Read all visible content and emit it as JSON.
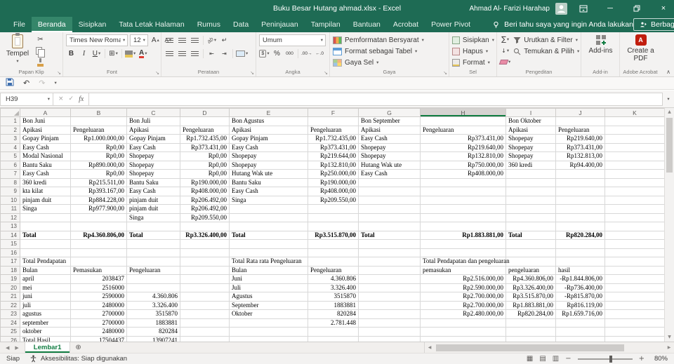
{
  "titlebar": {
    "title": "Buku Besar Hutang ahmad.xlsx  -  Excel",
    "user": "Ahmad Al- Farizi Harahap"
  },
  "tabs": {
    "items": [
      {
        "label": "File",
        "active": false
      },
      {
        "label": "Beranda",
        "active": true
      },
      {
        "label": "Sisipkan",
        "active": false
      },
      {
        "label": "Tata Letak Halaman",
        "active": false
      },
      {
        "label": "Rumus",
        "active": false
      },
      {
        "label": "Data",
        "active": false
      },
      {
        "label": "Peninjauan",
        "active": false
      },
      {
        "label": "Tampilan",
        "active": false
      },
      {
        "label": "Bantuan",
        "active": false
      },
      {
        "label": "Acrobat",
        "active": false
      },
      {
        "label": "Power Pivot",
        "active": false
      }
    ],
    "tellme": "Beri tahu saya yang ingin Anda lakukan",
    "share": "Berbagi"
  },
  "ribbon": {
    "clipboard": {
      "label": "Papan Klip",
      "paste": "Tempel"
    },
    "font": {
      "label": "Font",
      "name": "Times New Roman",
      "size": "12"
    },
    "alignment": {
      "label": "Perataan"
    },
    "number": {
      "label": "Angka",
      "format": "Umum"
    },
    "styles": {
      "label": "Gaya",
      "buttons": [
        "Pemformatan Bersyarat",
        "Format sebagai Tabel",
        "Gaya Sel"
      ]
    },
    "cells": {
      "label": "Sel",
      "buttons": [
        "Sisipkan",
        "Hapus",
        "Format"
      ]
    },
    "editing": {
      "label": "Pengeditan",
      "buttons": [
        "Urutkan & Filter",
        "Temukan & Pilih"
      ]
    },
    "addins": {
      "label": "Add-in",
      "button": "Add-ins"
    },
    "acrobat": {
      "label": "Adobe Acrobat",
      "button": "Create a PDF"
    }
  },
  "formula_bar": {
    "name_box": "H39"
  },
  "grid": {
    "columns": [
      "A",
      "B",
      "C",
      "D",
      "E",
      "F",
      "G",
      "H",
      "I",
      "J",
      "K"
    ],
    "selected_column": "H",
    "selected_cell": "H39",
    "bold_rows": [
      14
    ],
    "rows": [
      {
        "n": 1,
        "c": [
          "Bon Juni",
          "",
          "Bon Juli",
          "",
          "Bon Agustus",
          "",
          "Bon September",
          "",
          "Bon Oktober",
          "",
          ""
        ]
      },
      {
        "n": 2,
        "c": [
          "Apikasi",
          "Pengeluaran",
          "Apikasi",
          "Pengeluaran",
          "Apikasi",
          "Pengeluaran",
          "Apikasi",
          "Pengeluaran",
          "Apikasi",
          "Pengeluaran",
          ""
        ]
      },
      {
        "n": 3,
        "c": [
          "Gopay Pinjam",
          "Rp1.000.000,00",
          "Gopay Pinjam",
          "Rp1.732.435,00",
          "Gopay Pinjam",
          "Rp1.732.435,00",
          "Easy Cash",
          "Rp373.431,00",
          "Shopepay",
          "Rp219.640,00",
          ""
        ]
      },
      {
        "n": 4,
        "c": [
          "Easy Cash",
          "Rp0,00",
          "Easy Cash",
          "Rp373.431,00",
          "Easy Cash",
          "Rp373.431,00",
          "Shopepay",
          "Rp219.640,00",
          "Shopepay",
          "Rp373.431,00",
          ""
        ]
      },
      {
        "n": 5,
        "c": [
          "Modal Nasional",
          "Rp0,00",
          "Shopepay",
          "Rp0,00",
          "Shopepay",
          "Rp219.644,00",
          "Shopepay",
          "Rp132.810,00",
          "Shopepay",
          "Rp132.813,00",
          ""
        ]
      },
      {
        "n": 6,
        "c": [
          "Bantu Saku",
          "Rp890.000,00",
          "Shopepay",
          "Rp0,00",
          "Shopepay",
          "Rp132.810,00",
          "Hutang Wak ute",
          "Rp750.000,00",
          "360 kredi",
          "Rp94.400,00",
          ""
        ]
      },
      {
        "n": 7,
        "c": [
          "Easy Cash",
          "Rp0,00",
          "Shopepay",
          "Rp0,00",
          "Hutang Wak ute",
          "Rp250.000,00",
          "Easy Cash",
          "Rp408.000,00",
          "",
          "",
          ""
        ]
      },
      {
        "n": 8,
        "c": [
          "360 kredi",
          "Rp215.511,00",
          "Bantu Saku",
          "Rp190.000,00",
          "Bantu Saku",
          "Rp190.000,00",
          "",
          "",
          "",
          "",
          ""
        ]
      },
      {
        "n": 9,
        "c": [
          "kta kilat",
          "Rp393.167,00",
          "Easy Cash",
          "Rp408.000,00",
          "Easy Cash",
          "Rp408.000,00",
          "",
          "",
          "",
          "",
          ""
        ]
      },
      {
        "n": 10,
        "c": [
          "pinjam duit",
          "Rp884.228,00",
          "pinjam duit",
          "Rp206.492,00",
          "Singa",
          "Rp209.550,00",
          "",
          "",
          "",
          "",
          ""
        ]
      },
      {
        "n": 11,
        "c": [
          "Singa",
          "Rp977.900,00",
          "pinjam duit",
          "Rp206.492,00",
          "",
          "",
          "",
          "",
          "",
          "",
          ""
        ]
      },
      {
        "n": 12,
        "c": [
          "",
          "",
          "Singa",
          "Rp209.550,00",
          "",
          "",
          "",
          "",
          "",
          "",
          ""
        ]
      },
      {
        "n": 13,
        "c": [
          "",
          "",
          "",
          "",
          "",
          "",
          "",
          "",
          "",
          "",
          ""
        ]
      },
      {
        "n": 14,
        "c": [
          "Total",
          "Rp4.360.806,00",
          "Total",
          "Rp3.326.400,00",
          "Total",
          "Rp3.515.870,00",
          "Total",
          "Rp1.883.881,00",
          "Total",
          "Rp820.284,00",
          ""
        ]
      },
      {
        "n": 15,
        "c": [
          "",
          "",
          "",
          "",
          "",
          "",
          "",
          "",
          "",
          "",
          ""
        ]
      },
      {
        "n": 16,
        "c": [
          "",
          "",
          "",
          "",
          "",
          "",
          "",
          "",
          "",
          "",
          ""
        ]
      },
      {
        "n": 17,
        "c": [
          "Total Pendapatan",
          "",
          "",
          "",
          "Total Rata rata Pengeluaran",
          "",
          "",
          "Total Pendapatan dan pengeluaran",
          "",
          "",
          ""
        ]
      },
      {
        "n": 18,
        "c": [
          "Bulan",
          "Pemasukan",
          "Pengeluaran",
          "",
          "Bulan",
          "Pengeluaran",
          "",
          "pemasukan",
          "pengeluaran",
          "hasil",
          ""
        ]
      },
      {
        "n": 19,
        "c": [
          "april",
          "2038437",
          "",
          "",
          "Juni",
          "4.360.806",
          "",
          "Rp2.516.000,00",
          "Rp4.360.806,00",
          "-Rp1.844.806,00",
          ""
        ]
      },
      {
        "n": 20,
        "c": [
          "mei",
          "2516000",
          "",
          "",
          "Juli",
          "3.326.400",
          "",
          "Rp2.590.000,00",
          "Rp3.326.400,00",
          "-Rp736.400,00",
          ""
        ]
      },
      {
        "n": 21,
        "c": [
          "juni",
          "2590000",
          "4.360.806",
          "",
          "Agustus",
          "3515870",
          "",
          "Rp2.700.000,00",
          "Rp3.515.870,00",
          "-Rp815.870,00",
          ""
        ]
      },
      {
        "n": 22,
        "c": [
          "juli",
          "2480000",
          "3.326.400",
          "",
          "September",
          "1883881",
          "",
          "Rp2.700.000,00",
          "Rp1.883.881,00",
          "Rp816.119,00",
          ""
        ]
      },
      {
        "n": 23,
        "c": [
          "agustus",
          "2700000",
          "3515870",
          "",
          "Oktober",
          "820284",
          "",
          "Rp2.480.000,00",
          "Rp820.284,00",
          "Rp1.659.716,00",
          ""
        ]
      },
      {
        "n": 24,
        "c": [
          "september",
          "2700000",
          "1883881",
          "",
          "",
          "2.781.448",
          "",
          "",
          "",
          "",
          ""
        ]
      },
      {
        "n": 25,
        "c": [
          "oktober",
          "2480000",
          "820284",
          "",
          "",
          "",
          "",
          "",
          "",
          "",
          ""
        ]
      },
      {
        "n": 26,
        "c": [
          "Total Hasil",
          "17504437",
          "13907241",
          "",
          "",
          "",
          "",
          "",
          "",
          "",
          ""
        ]
      }
    ]
  },
  "sheet_bar": {
    "tabs": [
      {
        "label": "Lembar1",
        "active": true
      }
    ]
  },
  "status_bar": {
    "left": "Siap",
    "accessibility": "Aksesibilitas: Siap digunakan",
    "zoom": "80%"
  }
}
